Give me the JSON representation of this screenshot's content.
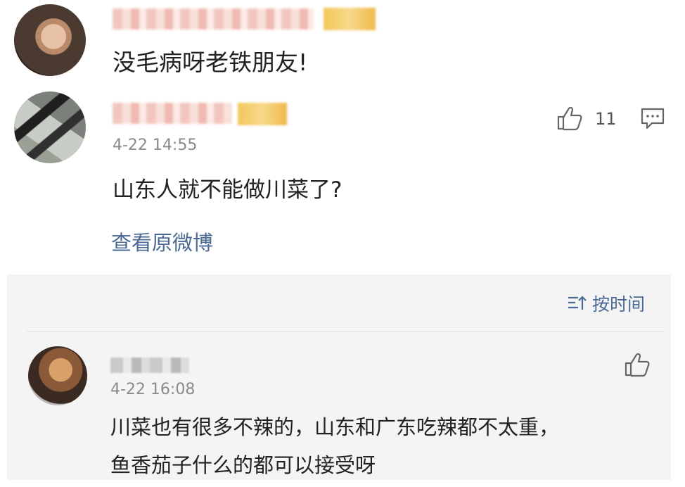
{
  "comments": [
    {
      "text": "没毛病呀老铁朋友!"
    },
    {
      "time": "4-22 14:55",
      "likes": "11",
      "text": "山东人就不能做川菜了?",
      "link": "查看原微博"
    }
  ],
  "replies_section": {
    "sort_label": "按时间"
  },
  "reply": {
    "time": "4-22 16:08",
    "line1": "川菜也有很多不辣的，山东和广东吃辣都不太重，",
    "line2": "鱼香茄子什么的都可以接受呀"
  },
  "icons": {
    "like": "thumbs-up-icon",
    "reply": "comment-icon",
    "sort": "sort-icon"
  },
  "colors": {
    "link": "#4a6a95",
    "timestamp": "#8a8a8a",
    "section_bg": "#f4f4f4"
  }
}
